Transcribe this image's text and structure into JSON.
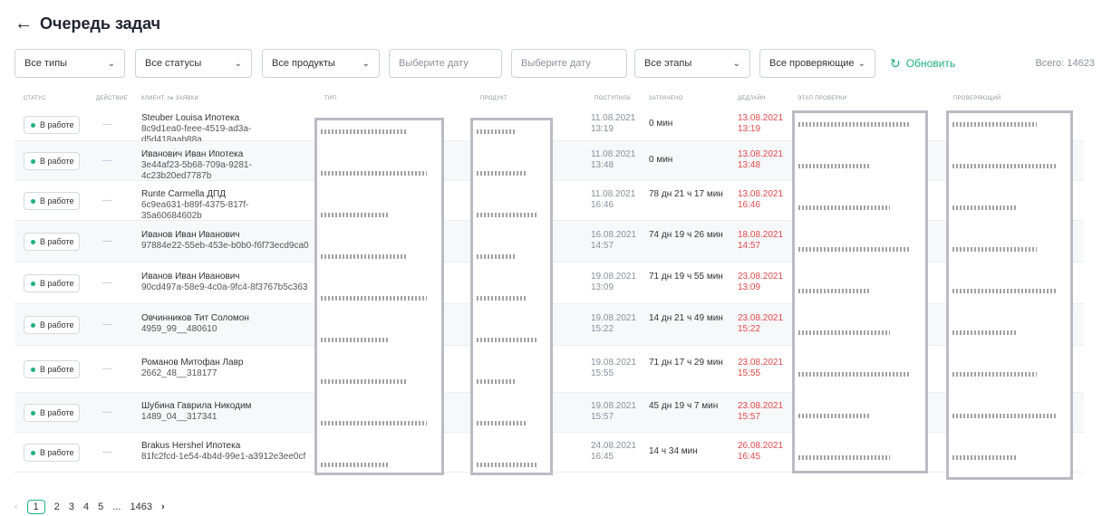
{
  "header": {
    "back_icon": "arrow-left-icon",
    "title": "Очередь задач"
  },
  "filters": {
    "types": "Все типы",
    "statuses": "Все статусы",
    "products": "Все продукты",
    "date_from_placeholder": "Выберите дату",
    "date_to_placeholder": "Выберите дату",
    "stages": "Все этапы",
    "reviewers": "Все проверяющие",
    "refresh": "Обновить",
    "total": "Всего: 14623"
  },
  "columns": {
    "status": "СТАТУС",
    "action": "ДЕЙСТВИЕ",
    "client": "КЛИЕНТ, № ЗАЯВКИ",
    "type": "ТИП",
    "product": "ПРОДУКТ",
    "received": "ПОСТУПИЛА",
    "spent": "ЗАТРАЧЕНО",
    "deadline": "ДЕДЛАЙН",
    "stage": "ЭТАП ПРОВЕРКИ",
    "reviewer": "ПРОВЕРЯЮЩИЙ"
  },
  "rows": [
    {
      "status": "В работе",
      "action": "—",
      "client": "Steuber Louisa Ипотека",
      "number": "8c9d1ea0-feee-4519-ad3a-d5d418aab88a",
      "received_date": "11.08.2021",
      "received_time": "13:19",
      "spent": "0 мин",
      "deadline_date": "13.08.2021",
      "deadline_time": "13:19"
    },
    {
      "status": "В работе",
      "action": "—",
      "client": "Иванович Иван Ипотека",
      "number": "3e44af23-5b68-709a-9281-4c23b20ed7787b",
      "received_date": "11.08.2021",
      "received_time": "13:48",
      "spent": "0 мин",
      "deadline_date": "13.08.2021",
      "deadline_time": "13:48"
    },
    {
      "status": "В работе",
      "action": "—",
      "client": "Runte Carmella ДПД",
      "number": "6c9ea631-b89f-4375-817f-35a60684602b",
      "received_date": "11.08.2021",
      "received_time": "16:46",
      "spent": "78 дн 21 ч 17 мин",
      "deadline_date": "13.08.2021",
      "deadline_time": "16:46"
    },
    {
      "status": "В работе",
      "action": "—",
      "client": "Иванов Иван Иванович",
      "number": "97884e22-55eb-453e-b0b0-f6f73ecd9ca0",
      "received_date": "16.08.2021",
      "received_time": "14:57",
      "spent": "74 дн 19 ч 26 мин",
      "deadline_date": "18.08.2021",
      "deadline_time": "14:57"
    },
    {
      "status": "В работе",
      "action": "—",
      "client": "Иванов Иван Иванович",
      "number": "90cd497a-58e9-4c0a-9fc4-8f3767b5c363",
      "received_date": "19.08.2021",
      "received_time": "13:09",
      "spent": "71 дн 19 ч 55 мин",
      "deadline_date": "23.08.2021",
      "deadline_time": "13:09"
    },
    {
      "status": "В работе",
      "action": "—",
      "client": "Овчинников Тит Соломон",
      "number": "4959_99__480610",
      "received_date": "19.08.2021",
      "received_time": "15:22",
      "spent": "14 дн 21 ч 49 мин",
      "deadline_date": "23.08.2021",
      "deadline_time": "15:22"
    },
    {
      "status": "В работе",
      "action": "—",
      "client": "Романов Митофан Лавр",
      "number": "2662_48__318177",
      "received_date": "19.08.2021",
      "received_time": "15:55",
      "spent": "71 дн 17 ч 29 мин",
      "deadline_date": "23.08.2021",
      "deadline_time": "15:55"
    },
    {
      "status": "В работе",
      "action": "—",
      "client": "Шубина Гаврила Никодим",
      "number": "1489_04__317341",
      "received_date": "19.08.2021",
      "received_time": "15:57",
      "spent": "45 дн 19 ч 7 мин",
      "deadline_date": "23.08.2021",
      "deadline_time": "15:57"
    },
    {
      "status": "В работе",
      "action": "—",
      "client": "Brakus Hershel Ипотека",
      "number": "81fc2fcd-1e54-4b4d-99e1-a3912e3ee0cf",
      "received_date": "24.08.2021",
      "received_time": "16:45",
      "spent": "14 ч 34 мин",
      "deadline_date": "26.08.2021",
      "deadline_time": "16:45"
    }
  ],
  "pagination": {
    "prev": "‹",
    "pages": [
      "1",
      "2",
      "3",
      "4",
      "5"
    ],
    "ellipsis": "...",
    "last": "1463",
    "next": "›",
    "current": "1"
  },
  "colors": {
    "accent": "#20b07a",
    "deadline": "#e04848",
    "muted": "#8a8f99"
  }
}
